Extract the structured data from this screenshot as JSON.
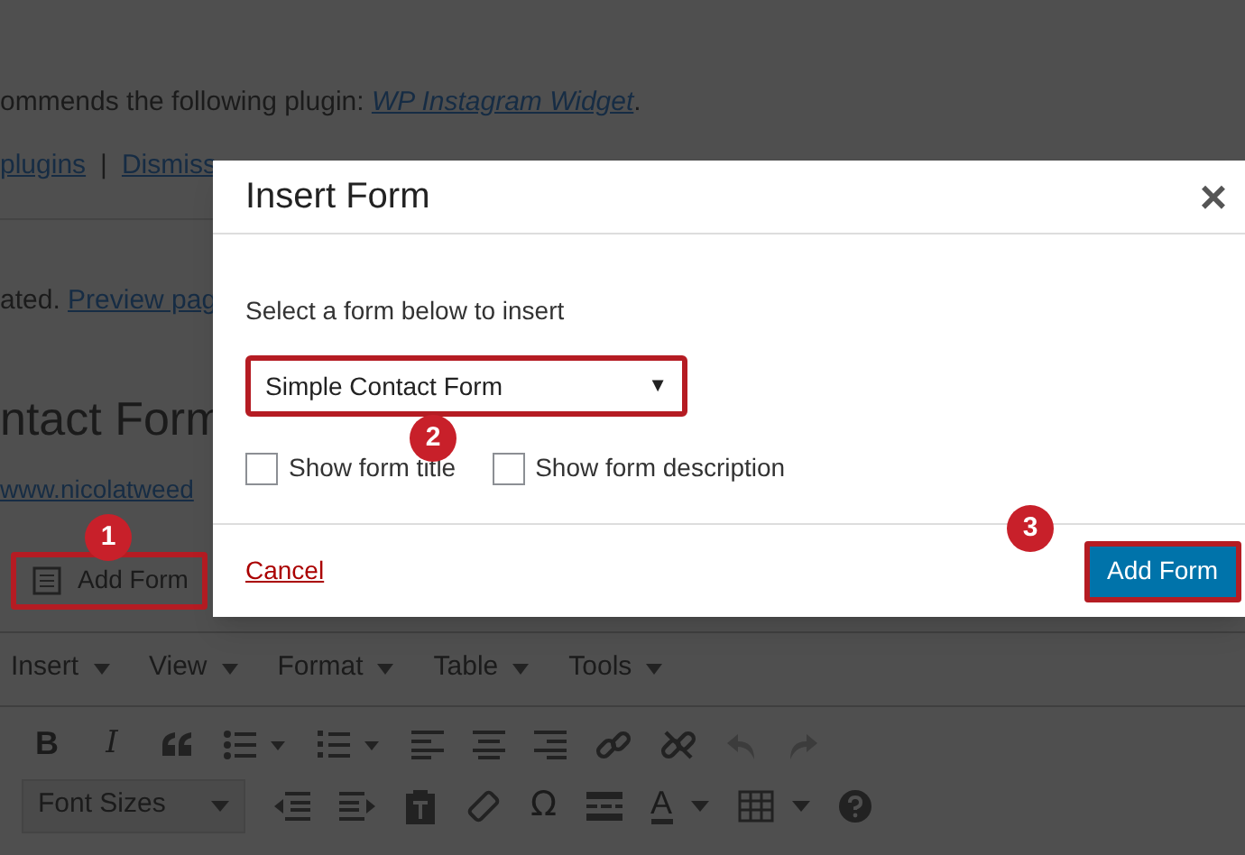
{
  "notice": {
    "text": "ommends the following plugin: ",
    "link": "WP Instagram Widget",
    "end": "."
  },
  "notice_links": {
    "install": "plugins",
    "separator": "|",
    "dismiss": "Dismiss"
  },
  "updated": {
    "text": "ated. ",
    "link": "Preview pag"
  },
  "page_title": "ntact Form",
  "permalink": "www.nicolatweed",
  "add_form_button": {
    "label": "Add Form",
    "step": "1"
  },
  "menu": [
    {
      "label": "Insert"
    },
    {
      "label": "View"
    },
    {
      "label": "Format"
    },
    {
      "label": "Table"
    },
    {
      "label": "Tools"
    }
  ],
  "toolbar": {
    "bold": "B",
    "italic": "I",
    "font_sizes": "Font Sizes",
    "omega": "Ω",
    "text_color": "A"
  },
  "dialog": {
    "title": "Insert Form",
    "close": "×",
    "prompt": "Select a form below to insert",
    "select": {
      "value": "Simple Contact Form",
      "arrow": "▼",
      "step": "2"
    },
    "options": [
      {
        "label": "Show form title",
        "checked": false
      },
      {
        "label": "Show form description",
        "checked": false
      }
    ],
    "cancel": "Cancel",
    "submit": {
      "label": "Add Form",
      "step": "3"
    }
  }
}
